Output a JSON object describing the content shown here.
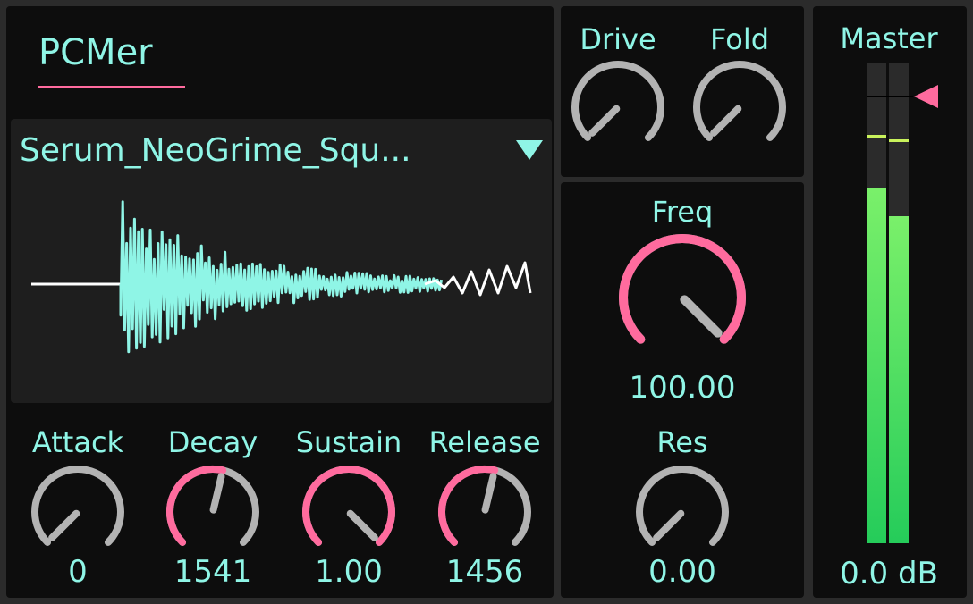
{
  "device": {
    "title": "PCMer",
    "sample_name": "Serum_NeoGrime_Squ...",
    "colors": {
      "accent": "#ff6b9e",
      "text": "#8ff5e6",
      "knob_off": "#b3b3b3",
      "wave": "#8ff5e6"
    }
  },
  "envelope": {
    "attack": {
      "label": "Attack",
      "value": "0",
      "position": 0.0,
      "active": false
    },
    "decay": {
      "label": "Decay",
      "value": "1541",
      "position": 0.55,
      "active": true
    },
    "sustain": {
      "label": "Sustain",
      "value": "1.00",
      "position": 1.0,
      "active": true
    },
    "release": {
      "label": "Release",
      "value": "1456",
      "position": 0.55,
      "active": true
    }
  },
  "drive": {
    "label": "Drive",
    "position": 0.0
  },
  "fold": {
    "label": "Fold",
    "position": 0.0
  },
  "filter": {
    "freq": {
      "label": "Freq",
      "value": "100.00",
      "position": 1.0,
      "active": true
    },
    "res": {
      "label": "Res",
      "value": "0.00",
      "position": 0.0,
      "active": false
    }
  },
  "master": {
    "label": "Master",
    "value": "0.0 dB",
    "meter_left_level": 0.74,
    "meter_right_level": 0.68,
    "fader_position": 1.0
  }
}
